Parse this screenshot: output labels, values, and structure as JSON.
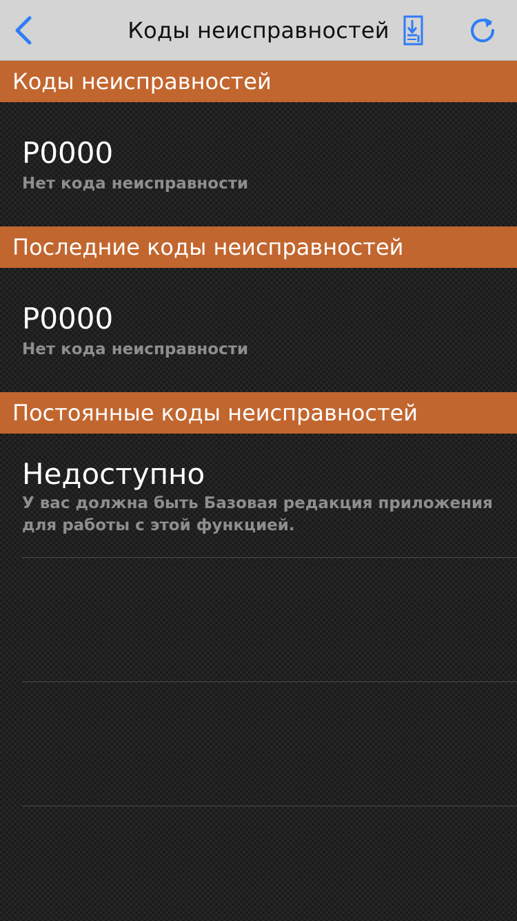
{
  "navbar": {
    "title": "Коды неисправностей",
    "back_icon": "chevron-left-icon",
    "save_icon": "save-download-icon",
    "refresh_icon": "refresh-icon",
    "accent_color": "#2f7cf6"
  },
  "sections": [
    {
      "header": "Коды неисправностей",
      "item": {
        "code": "P0000",
        "description": "Нет кода неисправности"
      }
    },
    {
      "header": "Последние коды неисправностей",
      "item": {
        "code": "P0000",
        "description": "Нет кода неисправности"
      }
    },
    {
      "header": "Постоянные коды неисправностей",
      "item": {
        "code": "Недоступно",
        "description": "У вас должна быть Базовая редакция приложения для работы с этой функцией."
      }
    }
  ],
  "colors": {
    "section_header": "#c2662f",
    "navbar_bg": "#d4d4d4",
    "description_text": "#8e8e8e"
  }
}
